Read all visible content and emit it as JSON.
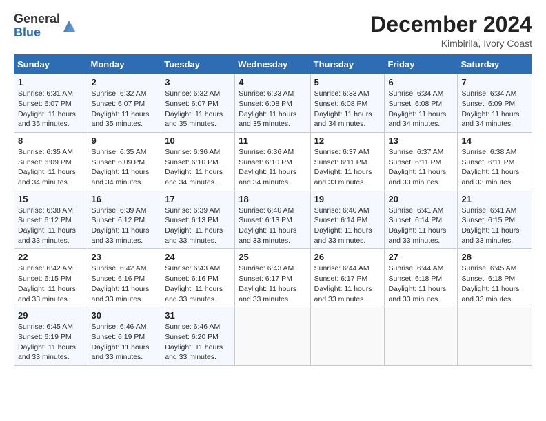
{
  "header": {
    "logo_general": "General",
    "logo_blue": "Blue",
    "month_year": "December 2024",
    "location": "Kimbirila, Ivory Coast"
  },
  "weekdays": [
    "Sunday",
    "Monday",
    "Tuesday",
    "Wednesday",
    "Thursday",
    "Friday",
    "Saturday"
  ],
  "weeks": [
    [
      {
        "day": "1",
        "sunrise": "Sunrise: 6:31 AM",
        "sunset": "Sunset: 6:07 PM",
        "daylight": "Daylight: 11 hours and 35 minutes."
      },
      {
        "day": "2",
        "sunrise": "Sunrise: 6:32 AM",
        "sunset": "Sunset: 6:07 PM",
        "daylight": "Daylight: 11 hours and 35 minutes."
      },
      {
        "day": "3",
        "sunrise": "Sunrise: 6:32 AM",
        "sunset": "Sunset: 6:07 PM",
        "daylight": "Daylight: 11 hours and 35 minutes."
      },
      {
        "day": "4",
        "sunrise": "Sunrise: 6:33 AM",
        "sunset": "Sunset: 6:08 PM",
        "daylight": "Daylight: 11 hours and 35 minutes."
      },
      {
        "day": "5",
        "sunrise": "Sunrise: 6:33 AM",
        "sunset": "Sunset: 6:08 PM",
        "daylight": "Daylight: 11 hours and 34 minutes."
      },
      {
        "day": "6",
        "sunrise": "Sunrise: 6:34 AM",
        "sunset": "Sunset: 6:08 PM",
        "daylight": "Daylight: 11 hours and 34 minutes."
      },
      {
        "day": "7",
        "sunrise": "Sunrise: 6:34 AM",
        "sunset": "Sunset: 6:09 PM",
        "daylight": "Daylight: 11 hours and 34 minutes."
      }
    ],
    [
      {
        "day": "8",
        "sunrise": "Sunrise: 6:35 AM",
        "sunset": "Sunset: 6:09 PM",
        "daylight": "Daylight: 11 hours and 34 minutes."
      },
      {
        "day": "9",
        "sunrise": "Sunrise: 6:35 AM",
        "sunset": "Sunset: 6:09 PM",
        "daylight": "Daylight: 11 hours and 34 minutes."
      },
      {
        "day": "10",
        "sunrise": "Sunrise: 6:36 AM",
        "sunset": "Sunset: 6:10 PM",
        "daylight": "Daylight: 11 hours and 34 minutes."
      },
      {
        "day": "11",
        "sunrise": "Sunrise: 6:36 AM",
        "sunset": "Sunset: 6:10 PM",
        "daylight": "Daylight: 11 hours and 34 minutes."
      },
      {
        "day": "12",
        "sunrise": "Sunrise: 6:37 AM",
        "sunset": "Sunset: 6:11 PM",
        "daylight": "Daylight: 11 hours and 33 minutes."
      },
      {
        "day": "13",
        "sunrise": "Sunrise: 6:37 AM",
        "sunset": "Sunset: 6:11 PM",
        "daylight": "Daylight: 11 hours and 33 minutes."
      },
      {
        "day": "14",
        "sunrise": "Sunrise: 6:38 AM",
        "sunset": "Sunset: 6:11 PM",
        "daylight": "Daylight: 11 hours and 33 minutes."
      }
    ],
    [
      {
        "day": "15",
        "sunrise": "Sunrise: 6:38 AM",
        "sunset": "Sunset: 6:12 PM",
        "daylight": "Daylight: 11 hours and 33 minutes."
      },
      {
        "day": "16",
        "sunrise": "Sunrise: 6:39 AM",
        "sunset": "Sunset: 6:12 PM",
        "daylight": "Daylight: 11 hours and 33 minutes."
      },
      {
        "day": "17",
        "sunrise": "Sunrise: 6:39 AM",
        "sunset": "Sunset: 6:13 PM",
        "daylight": "Daylight: 11 hours and 33 minutes."
      },
      {
        "day": "18",
        "sunrise": "Sunrise: 6:40 AM",
        "sunset": "Sunset: 6:13 PM",
        "daylight": "Daylight: 11 hours and 33 minutes."
      },
      {
        "day": "19",
        "sunrise": "Sunrise: 6:40 AM",
        "sunset": "Sunset: 6:14 PM",
        "daylight": "Daylight: 11 hours and 33 minutes."
      },
      {
        "day": "20",
        "sunrise": "Sunrise: 6:41 AM",
        "sunset": "Sunset: 6:14 PM",
        "daylight": "Daylight: 11 hours and 33 minutes."
      },
      {
        "day": "21",
        "sunrise": "Sunrise: 6:41 AM",
        "sunset": "Sunset: 6:15 PM",
        "daylight": "Daylight: 11 hours and 33 minutes."
      }
    ],
    [
      {
        "day": "22",
        "sunrise": "Sunrise: 6:42 AM",
        "sunset": "Sunset: 6:15 PM",
        "daylight": "Daylight: 11 hours and 33 minutes."
      },
      {
        "day": "23",
        "sunrise": "Sunrise: 6:42 AM",
        "sunset": "Sunset: 6:16 PM",
        "daylight": "Daylight: 11 hours and 33 minutes."
      },
      {
        "day": "24",
        "sunrise": "Sunrise: 6:43 AM",
        "sunset": "Sunset: 6:16 PM",
        "daylight": "Daylight: 11 hours and 33 minutes."
      },
      {
        "day": "25",
        "sunrise": "Sunrise: 6:43 AM",
        "sunset": "Sunset: 6:17 PM",
        "daylight": "Daylight: 11 hours and 33 minutes."
      },
      {
        "day": "26",
        "sunrise": "Sunrise: 6:44 AM",
        "sunset": "Sunset: 6:17 PM",
        "daylight": "Daylight: 11 hours and 33 minutes."
      },
      {
        "day": "27",
        "sunrise": "Sunrise: 6:44 AM",
        "sunset": "Sunset: 6:18 PM",
        "daylight": "Daylight: 11 hours and 33 minutes."
      },
      {
        "day": "28",
        "sunrise": "Sunrise: 6:45 AM",
        "sunset": "Sunset: 6:18 PM",
        "daylight": "Daylight: 11 hours and 33 minutes."
      }
    ],
    [
      {
        "day": "29",
        "sunrise": "Sunrise: 6:45 AM",
        "sunset": "Sunset: 6:19 PM",
        "daylight": "Daylight: 11 hours and 33 minutes."
      },
      {
        "day": "30",
        "sunrise": "Sunrise: 6:46 AM",
        "sunset": "Sunset: 6:19 PM",
        "daylight": "Daylight: 11 hours and 33 minutes."
      },
      {
        "day": "31",
        "sunrise": "Sunrise: 6:46 AM",
        "sunset": "Sunset: 6:20 PM",
        "daylight": "Daylight: 11 hours and 33 minutes."
      },
      null,
      null,
      null,
      null
    ]
  ]
}
